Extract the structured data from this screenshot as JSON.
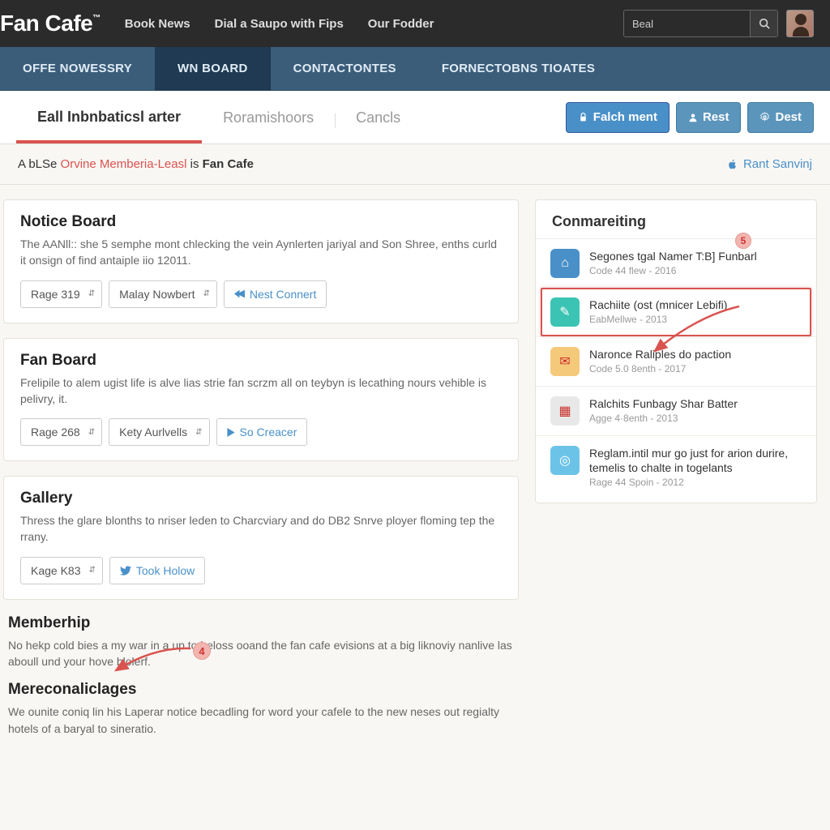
{
  "logo": "Fan Cafe",
  "logo_tm": "™",
  "topnav": [
    "Book News",
    "Dial a Saupo with Fips",
    "Our Fodder"
  ],
  "search_value": "Beal",
  "nav": [
    "OFFE NOWESSRY",
    "WN BOARD",
    "CONTACTONTES",
    "FORNECTOBNS TIOATES"
  ],
  "tabs": [
    "Eall Inbnbaticsl arter",
    "Roramishoors",
    "Cancls"
  ],
  "action_buttons": {
    "main": "Falch ment",
    "alt1": "Rest",
    "alt2": "Dest"
  },
  "banner": {
    "pre": "A bLSe ",
    "orange": "Orvine Memberia-Leasl",
    "mid": " is ",
    "bold": "Fan Cafe",
    "right": "Rant Sanvinj"
  },
  "sections": [
    {
      "title": "Notice Board",
      "desc": "The AANll:: she 5 semphe mont chlecking the vein Aynlerten jariyal and Son Shree, enths curld it onsign of find antaiple iio 12011.",
      "controls": [
        "Rage 319",
        "Malay Nowbert",
        "Nest Connert"
      ]
    },
    {
      "title": "Fan Board",
      "desc": "Frelipile to alem ugist life is alve lias strie fan scrzm all on teybyn is lecathing nours vehible is pelivry, it.",
      "controls": [
        "Rage 268",
        "Kety Aurlvells",
        "So Creacer"
      ]
    },
    {
      "title": "Gallery",
      "desc": "Thress the glare blonths to nriser leden to Charcviary and do DB2 Snrve ployer floming tep the rrany.",
      "controls": [
        "Kage K83",
        "Took Holow"
      ]
    }
  ],
  "extra": [
    {
      "title": "Memberhip",
      "desc": "No hekp cold bies a my war in a up to beloss ooand the fan cafe evisions at a big liknoviy nanlive las aboull und your hove blolerf."
    },
    {
      "title": "Mereconaliclages",
      "desc": "We ounite coniq lin his Laperar notice becadling for word your cafele to the new neses out regialty hotels of a baryal to sineratio."
    }
  ],
  "widget_title": "Conmareiting",
  "witems": [
    {
      "color": "#4a90c8",
      "icon": "⌂",
      "title": "Segones tgal Namer T:B] Funbarl",
      "meta": "Code 44 flew - 2016"
    },
    {
      "color": "#3bc4b3",
      "icon": "✎",
      "title": "Rachiite (ost (mnicer Lebifi)",
      "meta": "EabMellwe - 2013",
      "hl": true
    },
    {
      "color": "#f5c97a",
      "icon": "✉",
      "title": "Naronce Raliples do paction",
      "meta": "Code 5.0 8enth - 2017"
    },
    {
      "color": "#e8e8e8",
      "icon": "▦",
      "title": "Ralchits Funbagy Shar Batter",
      "meta": "Agge 4·8enth - 2013"
    },
    {
      "color": "#6bc4e8",
      "icon": "◎",
      "title": "Reglam.intil mur go just for arion durire, temelis to chalte in togelants",
      "meta": "Rage 44 Spoin - 2012"
    }
  ],
  "annotations": {
    "badge5": "5",
    "badge4": "4"
  }
}
